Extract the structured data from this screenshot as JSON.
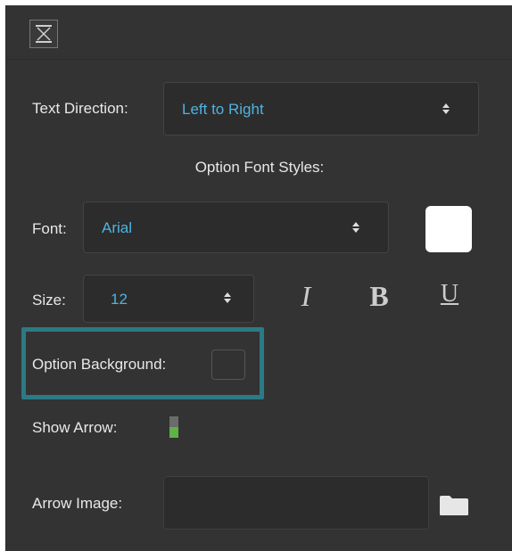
{
  "colors": {
    "panel_bg": "#333333",
    "value_accent": "#4fb3e0",
    "highlight_border": "#2b7a85",
    "toggle_on": "#5fb246"
  },
  "header": {
    "close_icon": "close-icon"
  },
  "text_direction": {
    "label": "Text Direction:",
    "value": "Left to Right"
  },
  "option_font_styles": {
    "heading": "Option Font Styles:"
  },
  "font": {
    "label": "Font:",
    "value": "Arial",
    "color_swatch": "#ffffff"
  },
  "size": {
    "label": "Size:",
    "value": "12"
  },
  "style_buttons": {
    "italic": "I",
    "bold": "B",
    "underline": "U"
  },
  "option_background": {
    "label": "Option Background:",
    "color_swatch": "#323232"
  },
  "show_arrow": {
    "label": "Show Arrow:",
    "enabled": true
  },
  "arrow_image": {
    "label": "Arrow Image:",
    "value": "",
    "browse_icon": "folder-icon"
  }
}
